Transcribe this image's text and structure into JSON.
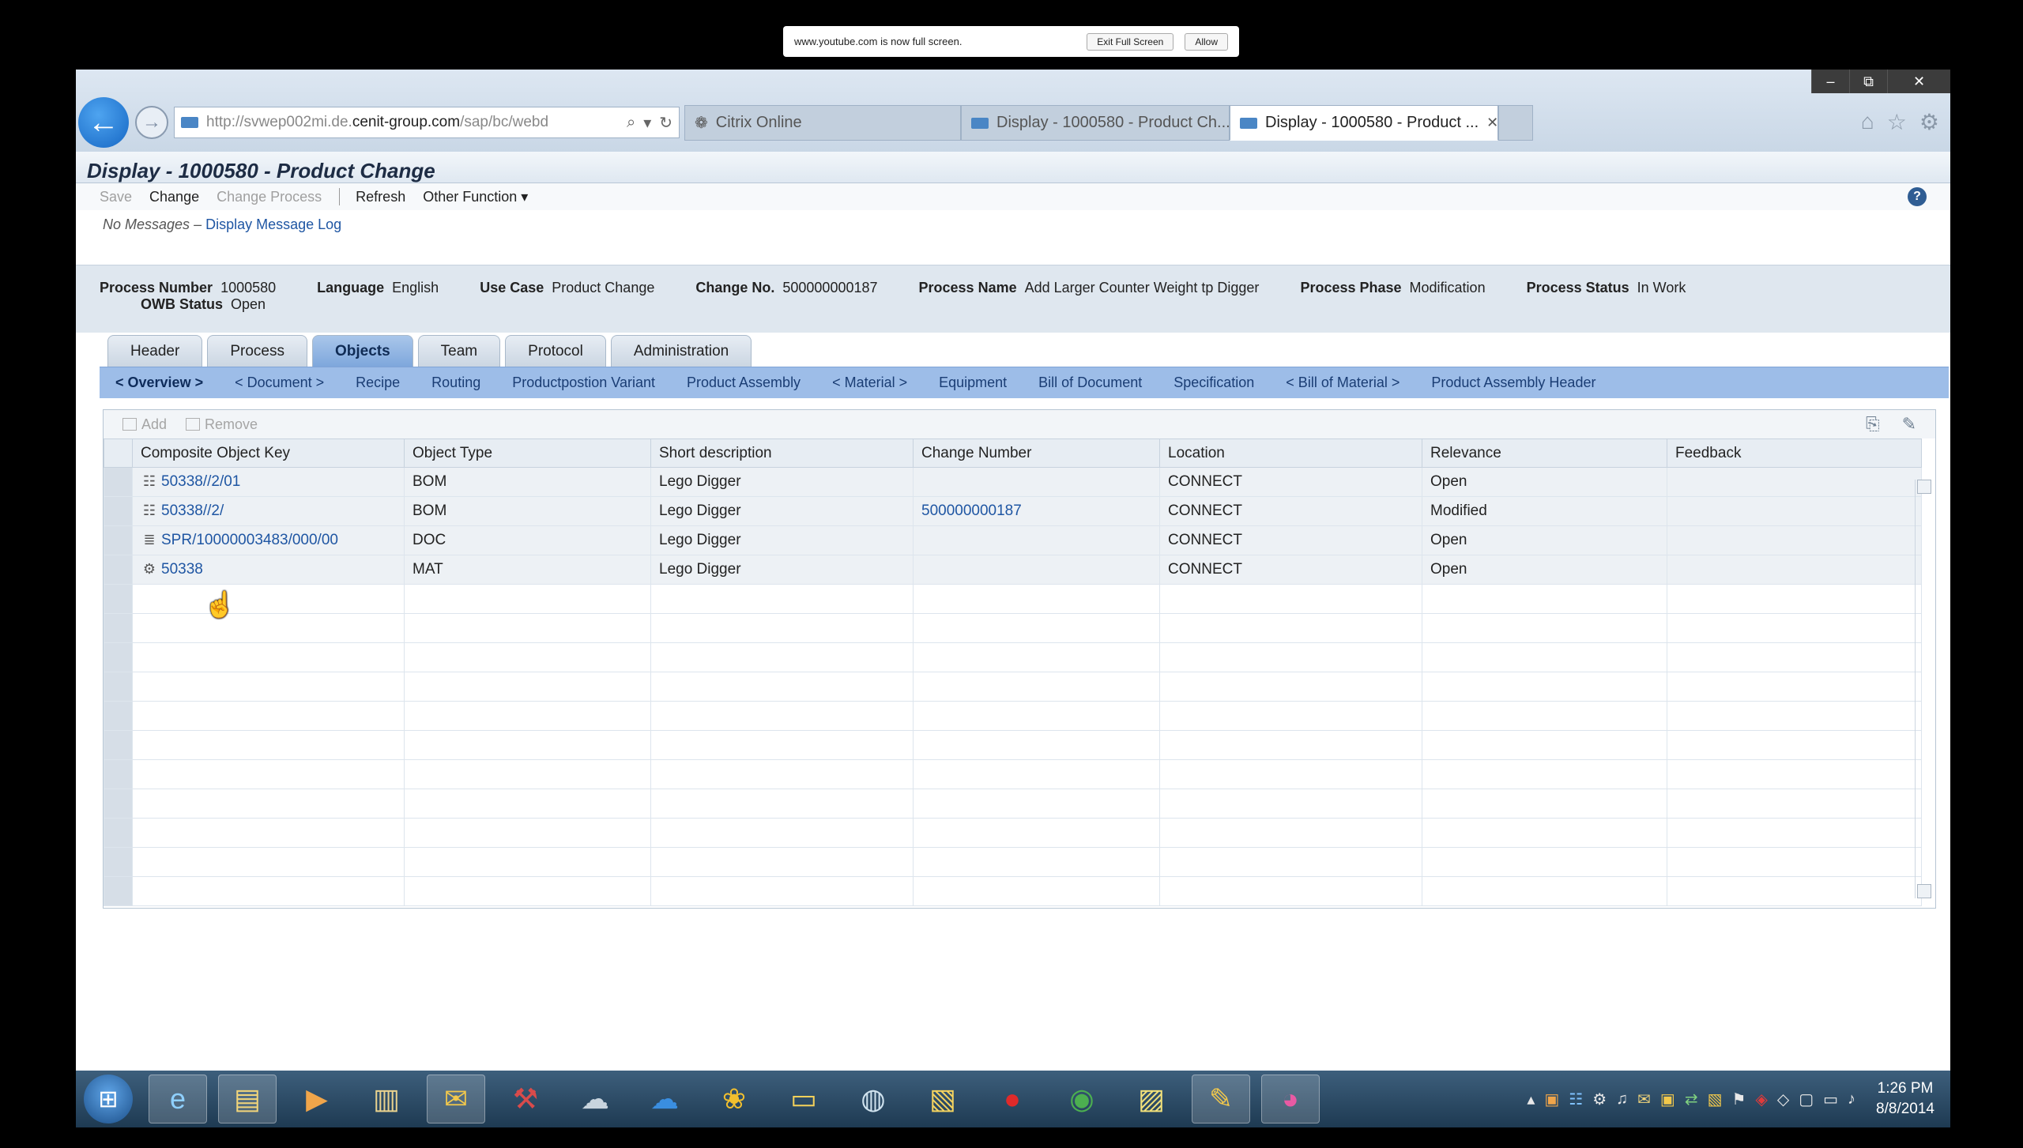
{
  "fullscreen": {
    "message": "www.youtube.com is now full screen.",
    "exit_label": "Exit Full Screen",
    "allow_label": "Allow"
  },
  "browser": {
    "window_controls": {
      "minimize": "–",
      "restore": "⧉",
      "close": "✕"
    },
    "url_prefix": "http://svwep002mi.de.",
    "url_domain": "cenit-group.com",
    "url_suffix": "/sap/bc/webd",
    "tabs": [
      {
        "label": "Citrix Online"
      },
      {
        "label": "Display - 1000580 - Product Ch..."
      },
      {
        "label": "Display - 1000580 - Product ..."
      }
    ]
  },
  "page": {
    "title": "Display - 1000580 - Product Change",
    "toolbar": {
      "save": "Save",
      "change": "Change",
      "change_process": "Change Process",
      "refresh": "Refresh",
      "other_function": "Other Function ▾"
    },
    "messages": {
      "status": "No Messages",
      "separator": " – ",
      "log_link": "Display Message Log"
    },
    "process": {
      "number_label": "Process Number",
      "number": "1000580",
      "language_label": "Language",
      "language": "English",
      "use_case_label": "Use Case",
      "use_case": "Product Change",
      "change_no_label": "Change No.",
      "change_no": "500000000187",
      "name_label": "Process Name",
      "name": "Add Larger Counter Weight tp Digger",
      "phase_label": "Process Phase",
      "phase": "Modification",
      "status_label": "Process Status",
      "status": "In Work",
      "owb_label": "OWB Status",
      "owb": "Open"
    },
    "tabs": [
      "Header",
      "Process",
      "Objects",
      "Team",
      "Protocol",
      "Administration"
    ],
    "subnav": [
      "< Overview >",
      "< Document >",
      "Recipe",
      "Routing",
      "Productpostion Variant",
      "Product Assembly",
      "< Material >",
      "Equipment",
      "Bill of Document",
      "Specification",
      "< Bill of Material >",
      "Product Assembly Header"
    ],
    "grid": {
      "add_label": "Add",
      "remove_label": "Remove",
      "columns": [
        "Composite Object Key",
        "Object Type",
        "Short description",
        "Change Number",
        "Location",
        "Relevance",
        "Feedback"
      ],
      "rows": [
        {
          "icon": "☷",
          "key": "50338//2/01",
          "type": "BOM",
          "desc": "Lego Digger",
          "change": "",
          "location": "CONNECT",
          "relevance": "Open",
          "feedback": ""
        },
        {
          "icon": "☷",
          "key": "50338//2/",
          "type": "BOM",
          "desc": "Lego Digger",
          "change": "500000000187",
          "location": "CONNECT",
          "relevance": "Modified",
          "feedback": ""
        },
        {
          "icon": "≣",
          "key": "SPR/10000003483/000/00",
          "type": "DOC",
          "desc": "Lego Digger",
          "change": "",
          "location": "CONNECT",
          "relevance": "Open",
          "feedback": ""
        },
        {
          "icon": "⚙",
          "key": "50338",
          "type": "MAT",
          "desc": "Lego Digger",
          "change": "",
          "location": "CONNECT",
          "relevance": "Open",
          "feedback": ""
        }
      ]
    }
  },
  "taskbar": {
    "time": "1:26 PM",
    "date": "8/8/2014",
    "icons": [
      "ie-icon",
      "file-explorer-icon",
      "media-player-icon",
      "documents-icon",
      "outlook-icon",
      "tool-icon",
      "network-icon",
      "cloud-icon",
      "flower-icon",
      "viewer-icon",
      "globe-icon",
      "folder-icon",
      "vodafone-icon",
      "chrome-icon",
      "files-icon",
      "notes-icon",
      "color-icon"
    ]
  }
}
